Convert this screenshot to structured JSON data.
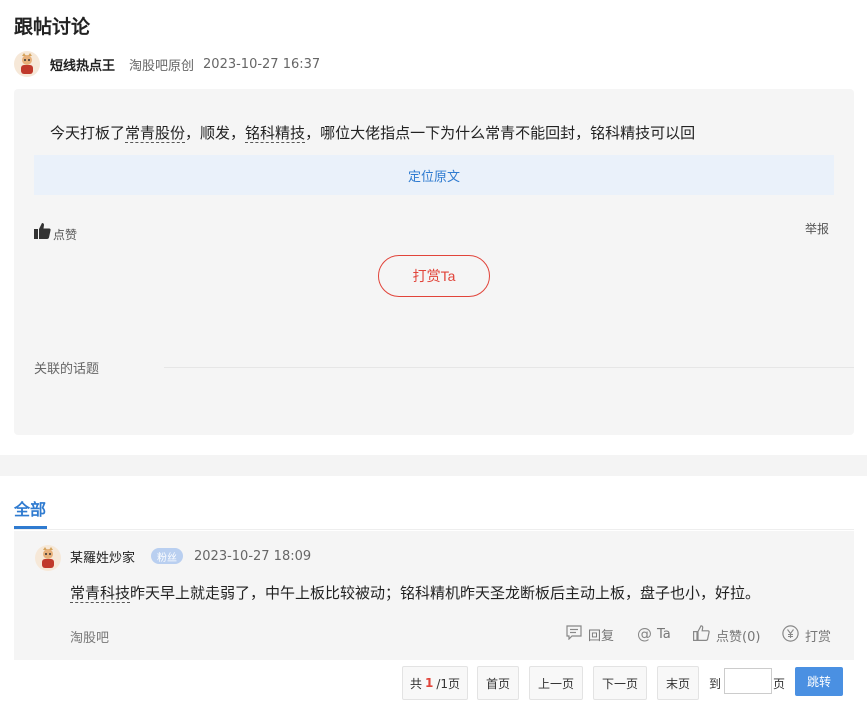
{
  "page": {
    "title": "跟帖讨论"
  },
  "post": {
    "author": "短线热点王",
    "source": "淘股吧原创",
    "time": "2023-10-27 16:37",
    "text_parts": [
      "今天打板了",
      "常青股份",
      "，顺发，",
      "铭科精技",
      "，哪位大佬指点一下为什么常青不能回封，铭科精技可以回"
    ],
    "locate_label": "定位原文",
    "like_label": "点赞",
    "report_label": "举报",
    "reward_label": "打赏Ta",
    "topics_label": "关联的话题"
  },
  "tabs": {
    "all_label": "全部"
  },
  "comment": {
    "author": "某羅姓炒家",
    "badge": "粉丝",
    "time": "2023-10-27 18:09",
    "text_parts": [
      "常青科技",
      "昨天早上就走弱了，中午上板比较被动；铭科精机昨天圣龙断板后主动上板，盘子也小，好拉。"
    ],
    "source": "淘股吧",
    "actions": {
      "reply": "回复",
      "at": "Ta",
      "like": "点赞(0)",
      "reward": "打赏"
    }
  },
  "pagination": {
    "total_prefix": "共",
    "current": "1",
    "total_suffix": "/1页",
    "first": "首页",
    "prev": "上一页",
    "next": "下一页",
    "last": "末页",
    "goto_label": "到",
    "page_unit": "页",
    "goto_value": "",
    "jump_label": "跳转"
  },
  "colors": {
    "accent": "#2f7bd0",
    "reward": "#e1443a",
    "card_bg": "#f5f5f5",
    "jump_button": "#4a90e2"
  },
  "icons": {
    "avatar": "cartoon-avatar-icon",
    "like": "thumbs-up-icon",
    "reply": "comment-icon",
    "at": "at-icon",
    "reward": "yen-icon"
  }
}
